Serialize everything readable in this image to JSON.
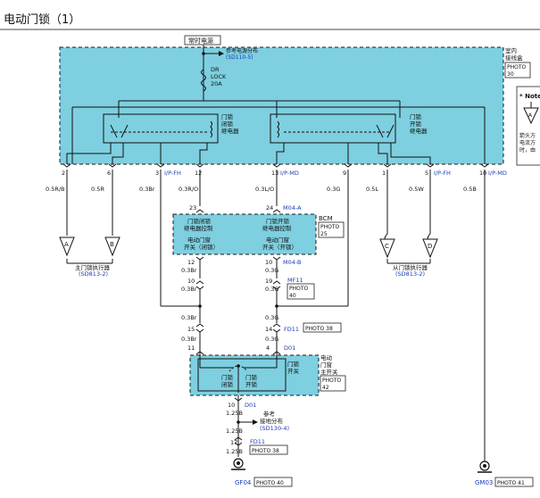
{
  "title": "电动门锁（1）",
  "header": {
    "power_label": "常时电源",
    "power_ref_line1": "参考电源分布",
    "power_ref_line2": "(SD110-5)",
    "fuse_line1": "DR",
    "fuse_line2": "LOCK",
    "fuse_line3": "20A",
    "box_name_line1": "室内",
    "box_name_line2": "接线盒",
    "photo_box": "PHOTO",
    "photo_box_num": "30"
  },
  "relays": {
    "lock_line1": "门锁",
    "lock_line2": "闭锁",
    "lock_line3": "继电器",
    "unlock_line1": "门锁",
    "unlock_line2": "开锁",
    "unlock_line3": "继电器"
  },
  "note": {
    "title": "* Note",
    "symbol": "A",
    "text1": "箭头方",
    "text2": "电流方",
    "text3": "时，由"
  },
  "pins": [
    {
      "num": "2",
      "wire": "0.5R/B"
    },
    {
      "num": "6",
      "wire": "0.5R"
    },
    {
      "num": "3",
      "wire": "0.3Br",
      "conn": "I/P-FH"
    },
    {
      "num": "12",
      "wire": "0.3R/O"
    },
    {
      "num": "13",
      "wire": "0.3L/O",
      "conn": "I/P-MD"
    },
    {
      "num": "9",
      "wire": "0.3G"
    },
    {
      "num": "1",
      "wire": "0.5L"
    },
    {
      "num": "5",
      "wire": "0.5W",
      "conn": "I/P-FH"
    },
    {
      "num": "10",
      "wire": "0.5B",
      "conn": "I/P-MD"
    }
  ],
  "arrows": [
    "A",
    "B",
    "C",
    "D"
  ],
  "main_actuator": {
    "line1": "主门锁执行器",
    "line2": "(SD813-2)"
  },
  "sub_actuator": {
    "line1": "从门锁执行器",
    "line2": "(SD813-2)"
  },
  "bcm": {
    "pin_left": "23",
    "pin_right": "24",
    "conn": "M04-A",
    "title": "BCM",
    "photo": "PHOTO",
    "photo_num": "25",
    "lock_ctrl_line1": "门锁闭锁",
    "lock_ctrl_line2": "继电器控制",
    "unlock_ctrl_line1": "门锁开锁",
    "unlock_ctrl_line2": "继电器控制",
    "sw_lock_line1": "电动门窗",
    "sw_lock_line2": "开关（闭锁）",
    "sw_unlock_line1": "电动门窗",
    "sw_unlock_line2": "开关（开锁）"
  },
  "m04b": {
    "pin_left": "12",
    "pin_right": "10",
    "conn": "M04-B",
    "wire_left": "0.3Br",
    "wire_right": "0.3G"
  },
  "mf11": {
    "pin_left": "10",
    "pin_right": "19",
    "conn": "MF11",
    "wire_left": "0.3Br",
    "wire_right": "0.3G",
    "photo": "PHOTO",
    "photo_num": "40"
  },
  "fd11": {
    "pin_left": "15",
    "pin_right": "14",
    "conn": "FD11",
    "wire_left_top": "0.3Br",
    "wire_right_top": "0.3G",
    "wire_left_bot": "0.3Br",
    "wire_right_bot": "0.3G",
    "photo": "PHOTO 38"
  },
  "d01": {
    "pin_left": "11",
    "pin_right": "4",
    "conn": "D01",
    "name_line1": "电动",
    "name_line2": "门窗",
    "name_line3": "主开关",
    "photo": "PHOTO",
    "photo_num": "42",
    "inner_line1": "门锁",
    "inner_line2": "开关",
    "lock_label_line1": "门锁",
    "lock_label_line2": "闭锁",
    "unlock_label_line1": "门锁",
    "unlock_label_line2": "开锁"
  },
  "ground_wire": {
    "pin": "10",
    "conn": "D01",
    "wire1": "1.25B",
    "wire2": "1.25B",
    "wire3": "1.25B",
    "ref_line1": "参考",
    "ref_line2": "接地分布",
    "ref_line3": "(SD130-4)",
    "fd11_pin": "17",
    "fd11_conn": "FD11",
    "fd11_photo": "PHOTO 38"
  },
  "grounds": {
    "left_name": "GF04",
    "left_photo": "PHOTO 40",
    "right_name": "GM03",
    "right_photo": "PHOTO 41"
  }
}
